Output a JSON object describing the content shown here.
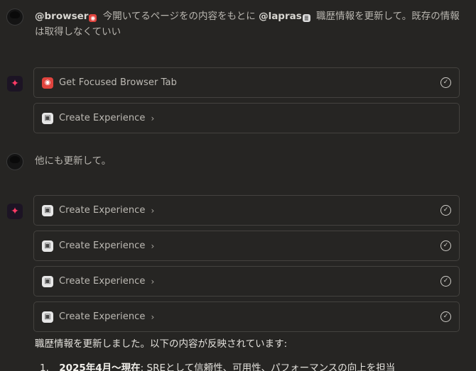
{
  "messages": [
    {
      "role": "user",
      "mention1": "@browser",
      "text1": " 今開いてるページをの内容をもとに ",
      "mention2": "@lapras",
      "text2": " 職歴情報を更新して。既存の情報は取得しなくていい"
    },
    {
      "role": "user",
      "text": "他にも更新して。"
    }
  ],
  "tool_groups": [
    {
      "cards": [
        {
          "label": "Get Focused Browser Tab",
          "icon": "browser-icon",
          "done": true,
          "expandable": false
        },
        {
          "label": "Create Experience",
          "icon": "experience-icon",
          "done": false,
          "expandable": true
        }
      ]
    },
    {
      "cards": [
        {
          "label": "Create Experience",
          "icon": "experience-icon",
          "done": true,
          "expandable": true
        },
        {
          "label": "Create Experience",
          "icon": "experience-icon",
          "done": true,
          "expandable": true
        },
        {
          "label": "Create Experience",
          "icon": "experience-icon",
          "done": true,
          "expandable": true
        },
        {
          "label": "Create Experience",
          "icon": "experience-icon",
          "done": true,
          "expandable": true
        }
      ]
    }
  ],
  "summary": {
    "text": "職歴情報を更新しました。以下の内容が反映されています:",
    "items": [
      {
        "num": "1.",
        "bold": "2025年4月〜現在",
        "rest": ": SREとして信頼性、可用性、パフォーマンスの向上を担当"
      }
    ]
  },
  "colors": {
    "background": "#262523",
    "card_border": "#44423f",
    "accent": "#ff3b66",
    "browser_icon": "#e0443e"
  }
}
